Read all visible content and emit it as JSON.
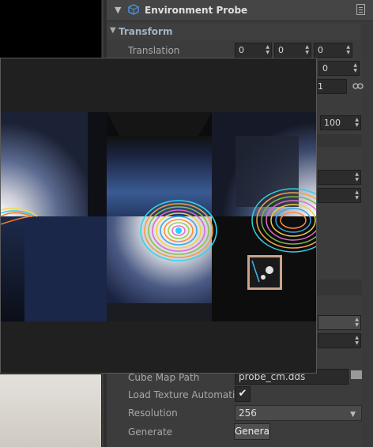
{
  "inspector": {
    "title": "Environment Probe",
    "section_transform": "Transform",
    "translation_label": "Translation",
    "translation_values": [
      "0",
      "0",
      "0"
    ],
    "row2_value": "0",
    "row3_value": "1",
    "value_100": "100",
    "cube_map_path_label": "Cube Map Path",
    "cube_map_path_value": "probe_cm.dds",
    "load_texture_label": "Load Texture Automatic",
    "resolution_label": "Resolution",
    "resolution_value": "256",
    "generate_label": "Generate",
    "generate_button": "Generate"
  },
  "icons": {
    "collapse": "chevron-down-icon",
    "component": "cube-icon",
    "menu": "menu-icon",
    "link": "link-icon",
    "folder": "folder-icon",
    "check": "checkmark-icon"
  },
  "colors": {
    "panel": "#3c3c3c",
    "section_text": "#a4b4c4",
    "component_icon": "#4a8fd6"
  }
}
